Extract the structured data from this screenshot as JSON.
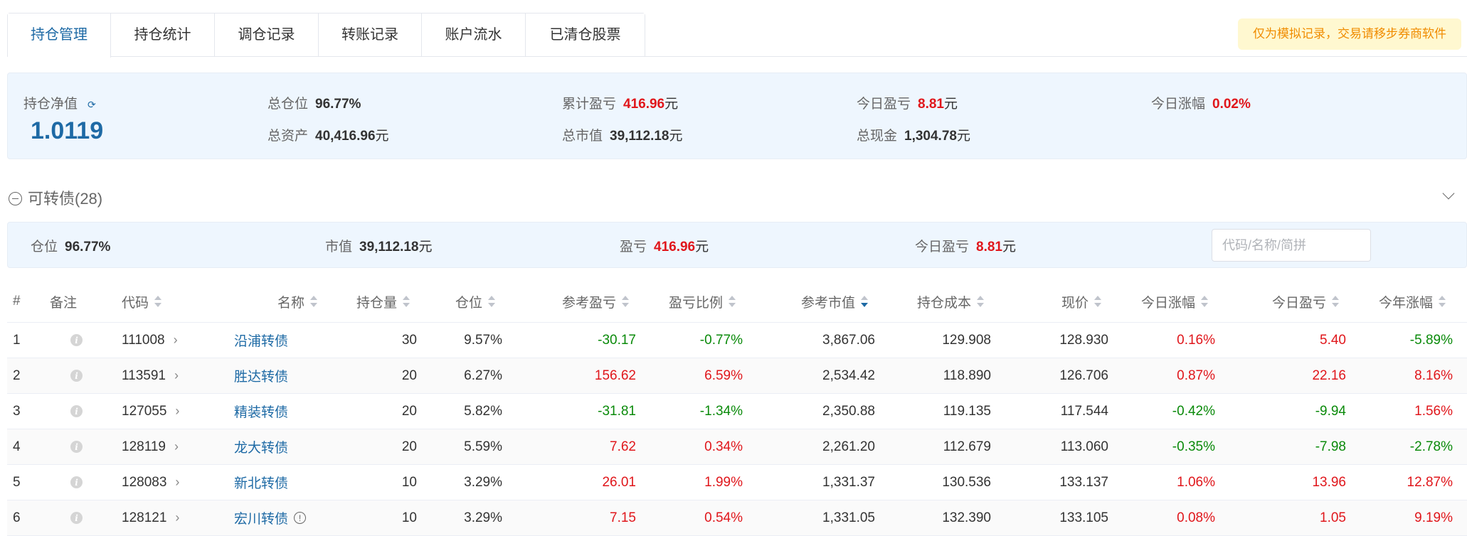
{
  "tabs": [
    "持仓管理",
    "持仓统计",
    "调仓记录",
    "转账记录",
    "账户流水",
    "已清仓股票"
  ],
  "active_tab": 0,
  "notice": "仅为模拟记录，交易请移步券商软件",
  "summary": {
    "nav_label": "持仓净值",
    "nav_value": "1.0119",
    "total_position_label": "总仓位",
    "total_position": "96.77%",
    "total_assets_label": "总资产",
    "total_assets": "40,416.96",
    "cum_pnl_label": "累计盈亏",
    "cum_pnl": "416.96",
    "market_value_label": "总市值",
    "market_value": "39,112.18",
    "today_pnl_label": "今日盈亏",
    "today_pnl": "8.81",
    "cash_label": "总现金",
    "cash": "1,304.78",
    "today_change_label": "今日涨幅",
    "today_change": "0.02%",
    "unit": "元"
  },
  "section": {
    "title": "可转债(28)"
  },
  "sub": {
    "position_label": "仓位",
    "position": "96.77%",
    "mv_label": "市值",
    "mv": "39,112.18",
    "pnl_label": "盈亏",
    "pnl": "416.96",
    "today_label": "今日盈亏",
    "today": "8.81",
    "unit": "元",
    "search_placeholder": "代码/名称/简拼"
  },
  "colors": {
    "red": "#e0161b",
    "green": "#0a8a0a",
    "blue": "#1e6aa5"
  },
  "columns": [
    "#",
    "备注",
    "代码",
    "名称",
    "持仓量",
    "仓位",
    "参考盈亏",
    "盈亏比例",
    "参考市值",
    "持仓成本",
    "现价",
    "今日涨幅",
    "今日盈亏",
    "今年涨幅"
  ],
  "rows": [
    {
      "idx": "1",
      "code": "111008",
      "name": "沿浦转债",
      "qty": "30",
      "pos": "9.57%",
      "pnl": "-30.17",
      "pnl_pct": "-0.77%",
      "mv": "3,867.06",
      "cost": "129.908",
      "price": "128.930",
      "chg": "0.16%",
      "today": "5.40",
      "ytd": "-5.89%"
    },
    {
      "idx": "2",
      "code": "113591",
      "name": "胜达转债",
      "qty": "20",
      "pos": "6.27%",
      "pnl": "156.62",
      "pnl_pct": "6.59%",
      "mv": "2,534.42",
      "cost": "118.890",
      "price": "126.706",
      "chg": "0.87%",
      "today": "22.16",
      "ytd": "8.16%"
    },
    {
      "idx": "3",
      "code": "127055",
      "name": "精装转债",
      "qty": "20",
      "pos": "5.82%",
      "pnl": "-31.81",
      "pnl_pct": "-1.34%",
      "mv": "2,350.88",
      "cost": "119.135",
      "price": "117.544",
      "chg": "-0.42%",
      "today": "-9.94",
      "ytd": "1.56%"
    },
    {
      "idx": "4",
      "code": "128119",
      "name": "龙大转债",
      "qty": "20",
      "pos": "5.59%",
      "pnl": "7.62",
      "pnl_pct": "0.34%",
      "mv": "2,261.20",
      "cost": "112.679",
      "price": "113.060",
      "chg": "-0.35%",
      "today": "-7.98",
      "ytd": "-2.78%"
    },
    {
      "idx": "5",
      "code": "128083",
      "name": "新北转债",
      "qty": "10",
      "pos": "3.29%",
      "pnl": "26.01",
      "pnl_pct": "1.99%",
      "mv": "1,331.37",
      "cost": "130.536",
      "price": "133.137",
      "chg": "1.06%",
      "today": "13.96",
      "ytd": "12.87%"
    },
    {
      "idx": "6",
      "code": "128121",
      "name": "宏川转债",
      "warn": "!",
      "qty": "10",
      "pos": "3.29%",
      "pnl": "7.15",
      "pnl_pct": "0.54%",
      "mv": "1,331.05",
      "cost": "132.390",
      "price": "133.105",
      "chg": "0.08%",
      "today": "1.05",
      "ytd": "9.19%"
    }
  ]
}
